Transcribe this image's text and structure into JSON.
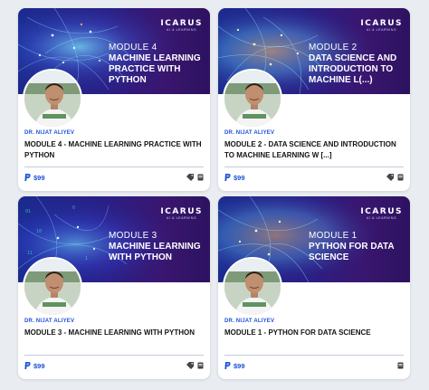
{
  "cards": [
    {
      "brand": "ICARUS",
      "brand_sub": "AI & LEARNING",
      "module_label": "MODULE 4",
      "banner_title": "MACHINE LEARNING PRACTICE WITH PYTHON",
      "author": "DR. NIJAT ALIYEV",
      "title": "MODULE 4 - MACHINE LEARNING PRACTICE WITH PYTHON",
      "price": "$99"
    },
    {
      "brand": "ICARUS",
      "brand_sub": "AI & LEARNING",
      "module_label": "MODULE 2",
      "banner_title": "DATA SCIENCE AND INTRODUCTION TO MACHINE L(...)",
      "author": "DR. NIJAT ALIYEV",
      "title": "MODULE 2 - DATA SCIENCE AND INTRODUCTION TO MACHINE LEARNING W [...]",
      "price": "$99"
    },
    {
      "brand": "ICARUS",
      "brand_sub": "AI & LEARNING",
      "module_label": "MODULE 3",
      "banner_title": "MACHINE LEARNING WITH PYTHON",
      "author": "DR. NIJAT ALIYEV",
      "title": "MODULE 3 - MACHINE LEARNING WITH PYTHON",
      "price": "$99"
    },
    {
      "brand": "ICARUS",
      "brand_sub": "AI & LEARNING",
      "module_label": "MODULE 1",
      "banner_title": "PYTHON FOR DATA SCIENCE",
      "author": "DR. NIJAT ALIYEV",
      "title": "MODULE 1 - PYTHON FOR DATA SCIENCE",
      "price": "$99"
    }
  ],
  "icons": {
    "payment": "paypal-icon",
    "tag": "tag-icon",
    "book": "book-icon"
  },
  "colors": {
    "accent": "#1e50d6",
    "banner_start": "#1b2a8f",
    "banner_end": "#2d1260",
    "glow": "#6ad0ff"
  }
}
